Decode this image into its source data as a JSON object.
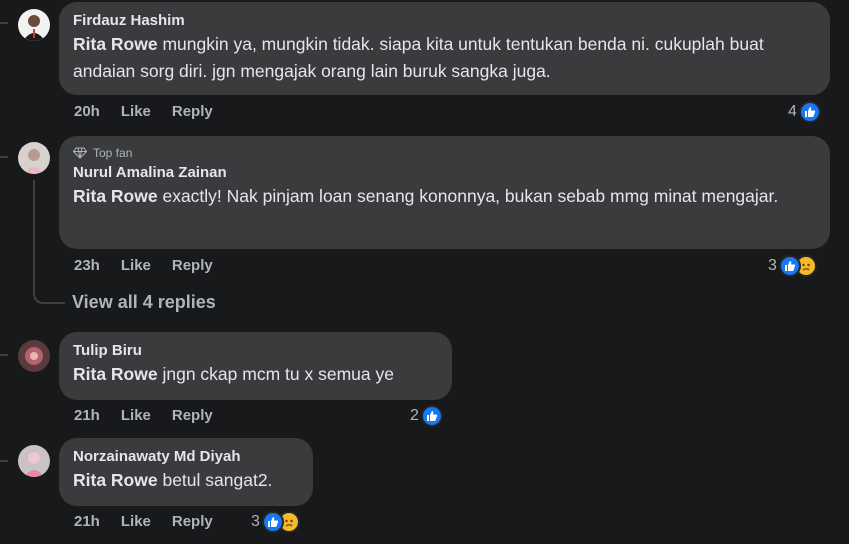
{
  "comments": [
    {
      "author": "Firdauz Hashim",
      "badge": "",
      "mention": "Rita Rowe",
      "text": " mungkin ya, mungkin tidak. siapa kita untuk tentukan benda ni. cukuplah buat andaian sorg diri. jgn mengajak orang lain buruk sangka juga.",
      "time": "20h",
      "like_label": "Like",
      "reply_label": "Reply",
      "reaction_count": "4",
      "reaction_icons": [
        "like-icon"
      ]
    },
    {
      "author": "Nurul Amalina Zainan",
      "badge": "Top fan",
      "mention": "Rita Rowe",
      "text": " exactly! Nak pinjam loan senang kononnya, bukan sebab mmg minat mengajar.",
      "time": "23h",
      "like_label": "Like",
      "reply_label": "Reply",
      "reaction_count": "3",
      "reaction_icons": [
        "like-icon",
        "sad-icon"
      ],
      "view_replies": "View all 4 replies"
    },
    {
      "author": "Tulip Biru",
      "badge": "",
      "mention": "Rita Rowe",
      "text": " jngn ckap mcm tu x semua ye",
      "time": "21h",
      "like_label": "Like",
      "reply_label": "Reply",
      "reaction_count": "2",
      "reaction_icons": [
        "like-icon"
      ]
    },
    {
      "author": "Norzainawaty Md Diyah",
      "badge": "",
      "mention": "Rita Rowe",
      "text": " betul sangat2.",
      "time": "21h",
      "like_label": "Like",
      "reply_label": "Reply",
      "reaction_count": "3",
      "reaction_icons": [
        "like-icon",
        "sad-icon"
      ]
    }
  ],
  "colors": {
    "background": "#18191a",
    "bubble": "#3a3b3c",
    "text_primary": "#e4e6eb",
    "text_secondary": "#b0b3b8",
    "like_blue": "#1877f2",
    "sad_yellow": "#f7b928"
  }
}
